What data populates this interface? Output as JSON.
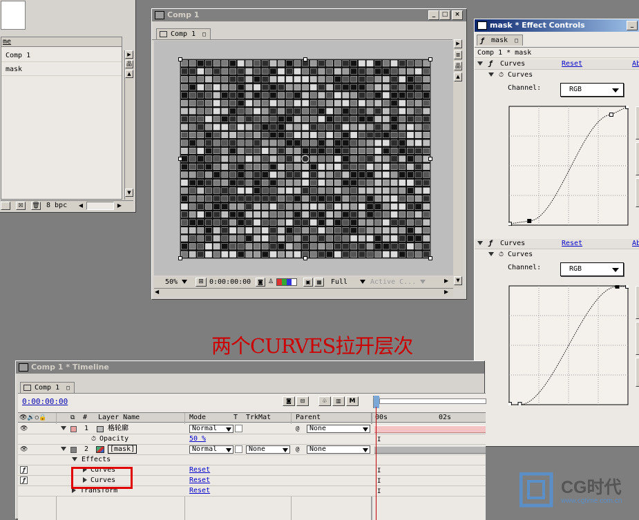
{
  "project_panel": {
    "header_text": "me",
    "items": [
      "Comp 1",
      "mask"
    ],
    "bpc": "8 bpc"
  },
  "comp_window": {
    "title": "Comp 1",
    "tab": "Comp 1",
    "zoom": "50%",
    "timecode": "0:00:00:00",
    "resolution": "Full",
    "camera": "Active C..."
  },
  "effect_controls": {
    "title": "mask * Effect Controls",
    "tab": "mask",
    "breadcrumb": "Comp 1 * mask",
    "effects": [
      {
        "name": "Curves",
        "reset": "Reset",
        "about": "Ab",
        "sub": "Curves",
        "channel_label": "Channel:",
        "channel": "RGB"
      },
      {
        "name": "Curves",
        "reset": "Reset",
        "about": "Ab",
        "sub": "Curves",
        "channel_label": "Channel:",
        "channel": "RGB"
      }
    ]
  },
  "annotation": "两个CURVES拉开层次",
  "timeline": {
    "title": "Comp 1 * Timeline",
    "tab": "Comp 1",
    "timecode": "0:00:00:00",
    "columns": {
      "num": "#",
      "layer_name": "Layer Name",
      "mode": "Mode",
      "t": "T",
      "trkmat": "TrkMat",
      "parent": "Parent"
    },
    "ruler": [
      "00s",
      "02s"
    ],
    "layers": [
      {
        "num": "1",
        "name": "格轮廓",
        "mode": "Normal",
        "trkmat": "",
        "parent": "None"
      },
      {
        "num": "2",
        "name": "[mask]",
        "mode": "Normal",
        "trkmat": "None",
        "parent": "None"
      }
    ],
    "opacity_label": "Opacity",
    "opacity_value": "50 %",
    "effects_label": "Effects",
    "curves1": "Curves",
    "curves2": "Curves",
    "transform": "Transform",
    "reset": "Reset"
  },
  "watermark": {
    "brand": "CG时代",
    "url": "www.cgtime.com.cn"
  },
  "colors": {
    "layer1_label": "#e8a0a0",
    "layer2_label": "#808080",
    "highlight_box": "#e00000",
    "annotation": "#cc0000",
    "playhead": "#c00000"
  }
}
